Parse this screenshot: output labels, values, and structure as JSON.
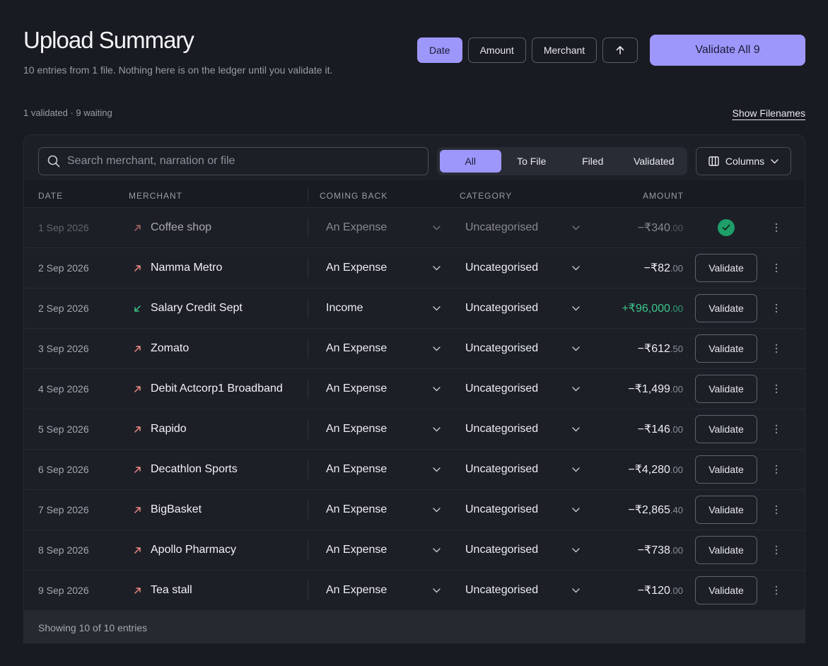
{
  "header": {
    "title": "Upload Summary",
    "subtitle": "10 entries from 1 file. Nothing here is on the ledger until you validate it.",
    "sort": {
      "date": "Date",
      "amount": "Amount",
      "merchant": "Merchant",
      "active": "date",
      "direction_icon": "arrow-up-icon"
    },
    "validate_all_label": "Validate All 9"
  },
  "status": {
    "summary": "1 validated · 9 waiting",
    "show_filenames_label": "Show Filenames"
  },
  "toolbar": {
    "search_placeholder": "Search merchant, narration or file",
    "filters": [
      "All",
      "To File",
      "Filed",
      "Validated"
    ],
    "active_filter": "All",
    "columns_label": "Columns"
  },
  "table": {
    "headers": {
      "date": "DATE",
      "merchant": "MERCHANT",
      "coming_back": "COMING BACK",
      "category": "CATEGORY",
      "amount": "AMOUNT"
    },
    "validate_label": "Validate",
    "rows": [
      {
        "date": "1 Sep 2026",
        "merchant": "Coffee shop",
        "direction": "out",
        "coming_back": "An Expense",
        "category": "Uncategorised",
        "amount": "−₹340",
        "cents": ".00",
        "validated": true
      },
      {
        "date": "2 Sep 2026",
        "merchant": "Namma Metro",
        "direction": "out",
        "coming_back": "An Expense",
        "category": "Uncategorised",
        "amount": "−₹82",
        "cents": ".00",
        "validated": false
      },
      {
        "date": "2 Sep 2026",
        "merchant": "Salary Credit Sept",
        "direction": "in",
        "coming_back": "Income",
        "category": "Uncategorised",
        "amount": "+₹96,000",
        "cents": ".00",
        "validated": false
      },
      {
        "date": "3 Sep 2026",
        "merchant": "Zomato",
        "direction": "out",
        "coming_back": "An Expense",
        "category": "Uncategorised",
        "amount": "−₹612",
        "cents": ".50",
        "validated": false
      },
      {
        "date": "4 Sep 2026",
        "merchant": "Debit Actcorp1 Broadband",
        "direction": "out",
        "coming_back": "An Expense",
        "category": "Uncategorised",
        "amount": "−₹1,499",
        "cents": ".00",
        "validated": false
      },
      {
        "date": "5 Sep 2026",
        "merchant": "Rapido",
        "direction": "out",
        "coming_back": "An Expense",
        "category": "Uncategorised",
        "amount": "−₹146",
        "cents": ".00",
        "validated": false
      },
      {
        "date": "6 Sep 2026",
        "merchant": "Decathlon Sports",
        "direction": "out",
        "coming_back": "An Expense",
        "category": "Uncategorised",
        "amount": "−₹4,280",
        "cents": ".00",
        "validated": false
      },
      {
        "date": "7 Sep 2026",
        "merchant": "BigBasket",
        "direction": "out",
        "coming_back": "An Expense",
        "category": "Uncategorised",
        "amount": "−₹2,865",
        "cents": ".40",
        "validated": false
      },
      {
        "date": "8 Sep 2026",
        "merchant": "Apollo Pharmacy",
        "direction": "out",
        "coming_back": "An Expense",
        "category": "Uncategorised",
        "amount": "−₹738",
        "cents": ".00",
        "validated": false
      },
      {
        "date": "9 Sep 2026",
        "merchant": "Tea stall",
        "direction": "out",
        "coming_back": "An Expense",
        "category": "Uncategorised",
        "amount": "−₹120",
        "cents": ".00",
        "validated": false
      }
    ]
  },
  "footer": {
    "showing": "Showing 10 of 10 entries"
  },
  "colors": {
    "accent": "#9e97fb",
    "expense_arrow": "#f08a82",
    "income_arrow": "#3bc68a",
    "validated": "#1e9e69",
    "background": "#191b22"
  }
}
